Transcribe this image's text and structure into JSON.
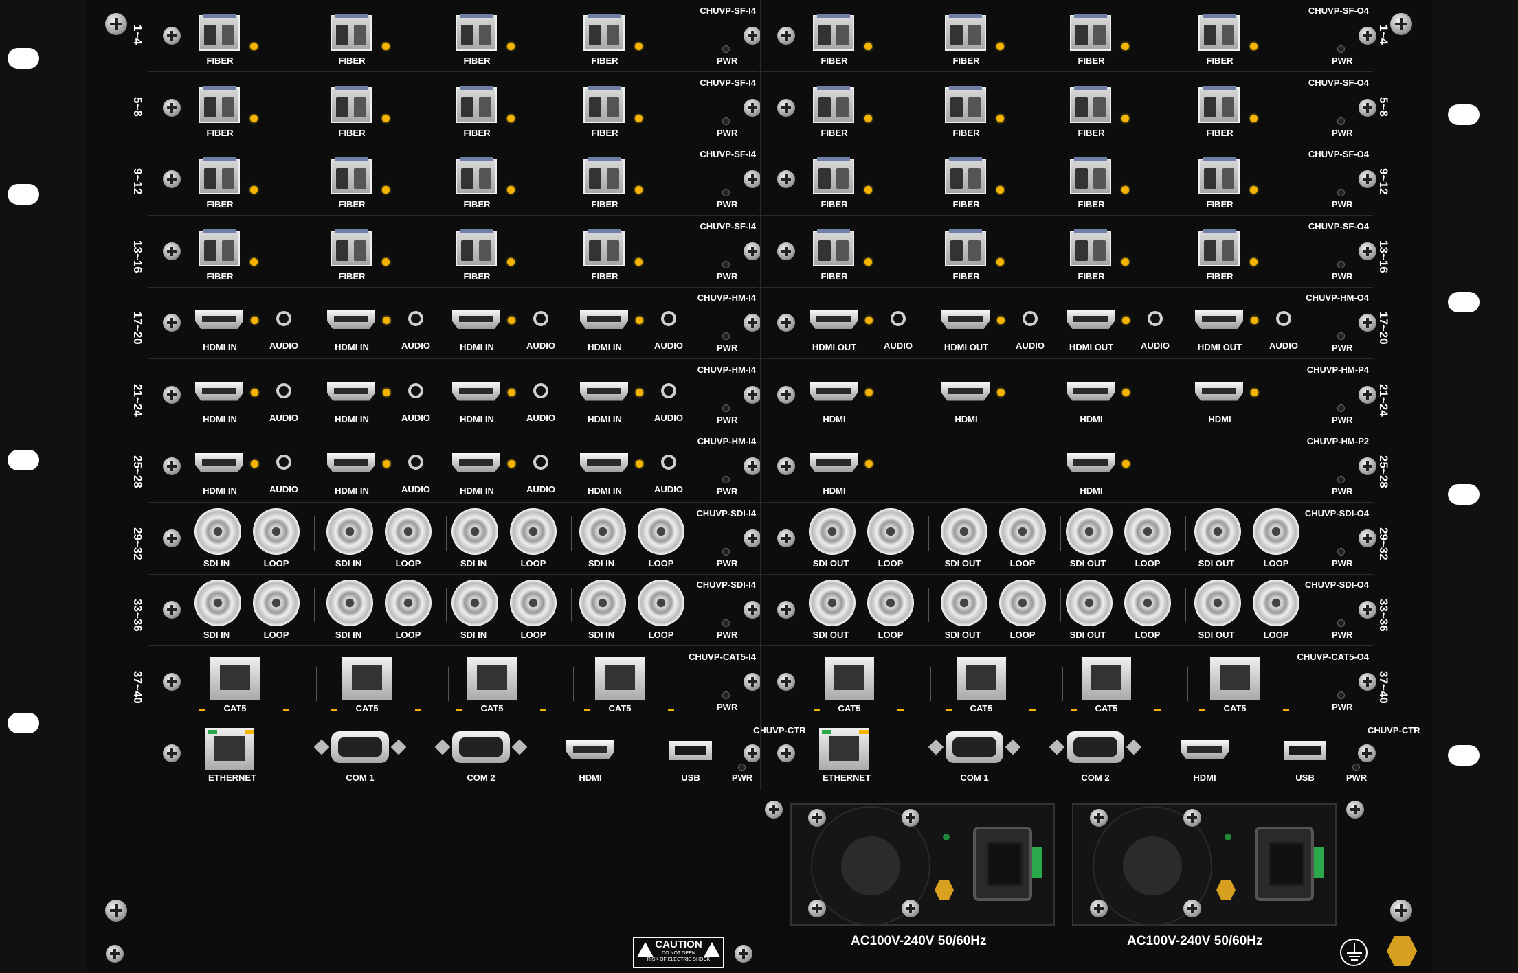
{
  "left_slot_labels": [
    "1~4",
    "5~8",
    "9~12",
    "13~16",
    "17~20",
    "21~24",
    "25~28",
    "29~32",
    "33~36",
    "37~40"
  ],
  "right_slot_labels": [
    "1~4",
    "5~8",
    "9~12",
    "13~16",
    "17~20",
    "21~24",
    "25~28",
    "29~32",
    "33~36",
    "37~40"
  ],
  "input_cards": [
    {
      "model": "CHUVP-SF-I4",
      "ports": [
        "FIBER",
        "FIBER",
        "FIBER",
        "FIBER"
      ],
      "pwr": "PWR"
    },
    {
      "model": "CHUVP-SF-I4",
      "ports": [
        "FIBER",
        "FIBER",
        "FIBER",
        "FIBER"
      ],
      "pwr": "PWR"
    },
    {
      "model": "CHUVP-SF-I4",
      "ports": [
        "FIBER",
        "FIBER",
        "FIBER",
        "FIBER"
      ],
      "pwr": "PWR"
    },
    {
      "model": "CHUVP-SF-I4",
      "ports": [
        "FIBER",
        "FIBER",
        "FIBER",
        "FIBER"
      ],
      "pwr": "PWR"
    },
    {
      "model": "CHUVP-HM-I4",
      "ports": [
        "HDMI IN",
        "HDMI IN",
        "HDMI IN",
        "HDMI IN"
      ],
      "audio": [
        "AUDIO",
        "AUDIO",
        "AUDIO",
        "AUDIO"
      ],
      "pwr": "PWR"
    },
    {
      "model": "CHUVP-HM-I4",
      "ports": [
        "HDMI IN",
        "HDMI IN",
        "HDMI IN",
        "HDMI IN"
      ],
      "audio": [
        "AUDIO",
        "AUDIO",
        "AUDIO",
        "AUDIO"
      ],
      "pwr": "PWR"
    },
    {
      "model": "CHUVP-HM-I4",
      "ports": [
        "HDMI IN",
        "HDMI IN",
        "HDMI IN",
        "HDMI IN"
      ],
      "audio": [
        "AUDIO",
        "AUDIO",
        "AUDIO",
        "AUDIO"
      ],
      "pwr": "PWR"
    },
    {
      "model": "CHUVP-SDI-I4",
      "ports": [
        "SDI IN",
        "SDI IN",
        "SDI IN",
        "SDI IN"
      ],
      "loops": [
        "LOOP",
        "LOOP",
        "LOOP",
        "LOOP"
      ],
      "pwr": "PWR"
    },
    {
      "model": "CHUVP-SDI-I4",
      "ports": [
        "SDI IN",
        "SDI IN",
        "SDI IN",
        "SDI IN"
      ],
      "loops": [
        "LOOP",
        "LOOP",
        "LOOP",
        "LOOP"
      ],
      "pwr": "PWR"
    },
    {
      "model": "CHUVP-CAT5-I4",
      "ports": [
        "CAT5",
        "CAT5",
        "CAT5",
        "CAT5"
      ],
      "pwr": "PWR"
    }
  ],
  "output_cards": [
    {
      "model": "CHUVP-SF-O4",
      "ports": [
        "FIBER",
        "FIBER",
        "FIBER",
        "FIBER"
      ],
      "pwr": "PWR"
    },
    {
      "model": "CHUVP-SF-O4",
      "ports": [
        "FIBER",
        "FIBER",
        "FIBER",
        "FIBER"
      ],
      "pwr": "PWR"
    },
    {
      "model": "CHUVP-SF-O4",
      "ports": [
        "FIBER",
        "FIBER",
        "FIBER",
        "FIBER"
      ],
      "pwr": "PWR"
    },
    {
      "model": "CHUVP-SF-O4",
      "ports": [
        "FIBER",
        "FIBER",
        "FIBER",
        "FIBER"
      ],
      "pwr": "PWR"
    },
    {
      "model": "CHUVP-HM-O4",
      "ports": [
        "HDMI OUT",
        "HDMI OUT",
        "HDMI OUT",
        "HDMI OUT"
      ],
      "audio": [
        "AUDIO",
        "AUDIO",
        "AUDIO",
        "AUDIO"
      ],
      "pwr": "PWR"
    },
    {
      "model": "CHUVP-HM-P4",
      "ports": [
        "HDMI",
        "HDMI",
        "HDMI",
        "HDMI"
      ],
      "pwr": "PWR"
    },
    {
      "model": "CHUVP-HM-P2",
      "ports": [
        "HDMI",
        "HDMI"
      ],
      "pwr": "PWR"
    },
    {
      "model": "CHUVP-SDI-O4",
      "ports": [
        "SDI OUT",
        "SDI OUT",
        "SDI OUT",
        "SDI OUT"
      ],
      "loops": [
        "LOOP",
        "LOOP",
        "LOOP",
        "LOOP"
      ],
      "pwr": "PWR"
    },
    {
      "model": "CHUVP-SDI-O4",
      "ports": [
        "SDI OUT",
        "SDI OUT",
        "SDI OUT",
        "SDI OUT"
      ],
      "loops": [
        "LOOP",
        "LOOP",
        "LOOP",
        "LOOP"
      ],
      "pwr": "PWR"
    },
    {
      "model": "CHUVP-CAT5-O4",
      "ports": [
        "CAT5",
        "CAT5",
        "CAT5",
        "CAT5"
      ],
      "pwr": "PWR"
    }
  ],
  "control_left": {
    "model": "CHUVP-CTR",
    "ethernet": "ETHERNET",
    "com1": "COM 1",
    "com2": "COM 2",
    "hdmi": "HDMI",
    "usb": "USB",
    "pwr": "PWR"
  },
  "control_right": {
    "model": "CHUVP-CTR",
    "ethernet": "ETHERNET",
    "com1": "COM 1",
    "com2": "COM 2",
    "hdmi": "HDMI",
    "usb": "USB",
    "pwr": "PWR"
  },
  "psu": [
    "AC100V-240V 50/60Hz",
    "AC100V-240V 50/60Hz"
  ],
  "caution": {
    "title": "CAUTION",
    "line1": "DO NOT OPEN",
    "line2": "RISK OF ELECTRIC SHOCK"
  },
  "colors": {
    "panel": "#0d0d0d",
    "led": "#f4b400",
    "ear": "#111111"
  },
  "icon_names": [
    "screw-icon",
    "sfp-fiber-port-icon",
    "hdmi-port-icon",
    "audio-jack-icon",
    "bnc-connector-icon",
    "rj45-port-icon",
    "db9-serial-port-icon",
    "usb-port-icon",
    "power-inlet-icon",
    "fan-icon",
    "ground-icon",
    "warning-icon"
  ]
}
